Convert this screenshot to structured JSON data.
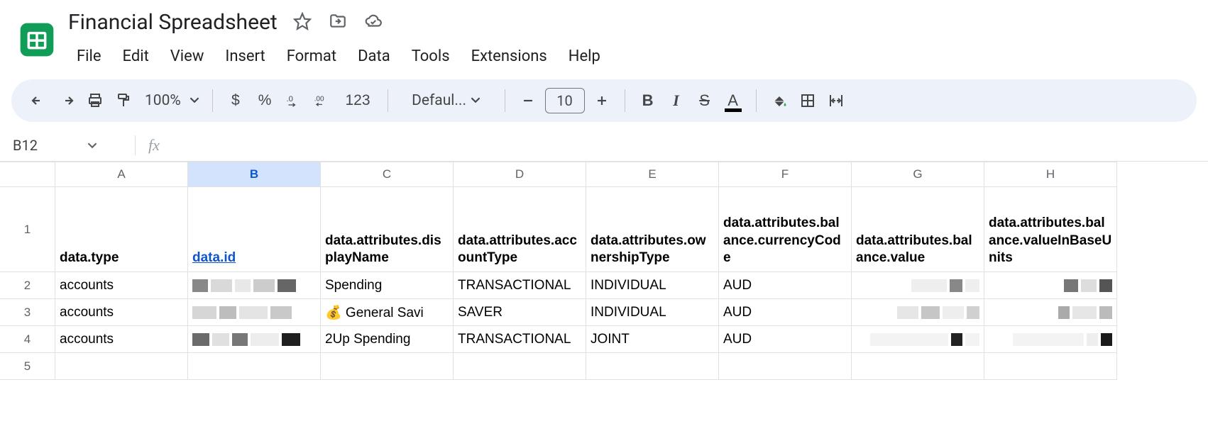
{
  "doc": {
    "title": "Financial Spreadsheet"
  },
  "menubar": [
    "File",
    "Edit",
    "View",
    "Insert",
    "Format",
    "Data",
    "Tools",
    "Extensions",
    "Help"
  ],
  "toolbar": {
    "zoom": "100%",
    "currency": "$",
    "percent": "%",
    "dec_decrease": ".0",
    "dec_increase": ".00",
    "more_formats": "123",
    "font": "Defaul...",
    "font_size": "10",
    "bold": "B",
    "italic": "I",
    "strike": "S",
    "text_color": "A"
  },
  "namebox": "B12",
  "columns": [
    "A",
    "B",
    "C",
    "D",
    "E",
    "F",
    "G",
    "H"
  ],
  "selected_col_index": 1,
  "header_row": [
    "data.type",
    "data.id",
    "data.attributes.displayName",
    "data.attributes.accountType",
    "data.attributes.ownershipType",
    "data.attributes.balance.currencyCode",
    "data.attributes.balance.value",
    "data.attributes.balance.valueInBaseUnits"
  ],
  "rows": [
    {
      "r": "2",
      "type": "accounts",
      "id": "[redacted]",
      "displayName": "Spending",
      "accountType": "TRANSACTIONAL",
      "ownershipType": "INDIVIDUAL",
      "currencyCode": "AUD",
      "balanceValue": "[redacted]",
      "balanceBase": "[redacted]"
    },
    {
      "r": "3",
      "type": "accounts",
      "id": "[redacted]",
      "displayName": "💰 General Savi",
      "accountType": "SAVER",
      "ownershipType": "INDIVIDUAL",
      "currencyCode": "AUD",
      "balanceValue": "[redacted]",
      "balanceBase": "[redacted]"
    },
    {
      "r": "4",
      "type": "accounts",
      "id": "[redacted]",
      "displayName": "2Up Spending",
      "accountType": "TRANSACTIONAL",
      "ownershipType": "JOINT",
      "currencyCode": "AUD",
      "balanceValue": "[redacted]",
      "balanceBase": "[redacted]"
    }
  ],
  "row_labels": [
    "1",
    "2",
    "3",
    "4",
    "5"
  ]
}
